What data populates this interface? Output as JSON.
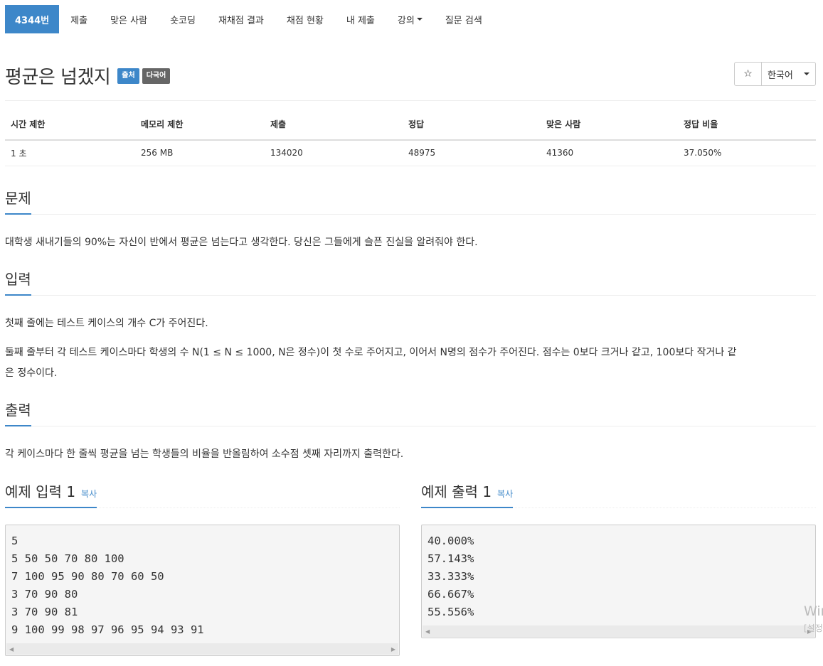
{
  "nav": {
    "items": [
      {
        "label": "4344번",
        "active": true
      },
      {
        "label": "제출"
      },
      {
        "label": "맞은 사람"
      },
      {
        "label": "숏코딩"
      },
      {
        "label": "재채점 결과"
      },
      {
        "label": "채점 현황"
      },
      {
        "label": "내 제출"
      },
      {
        "label": "강의",
        "dropdown": true
      },
      {
        "label": "질문 검색"
      }
    ]
  },
  "problem": {
    "title": "평균은 넘겠지",
    "labels": {
      "source": "출처",
      "multilang": "다국어"
    }
  },
  "toolbar": {
    "star": "☆",
    "language": "한국어"
  },
  "info_table": {
    "headers": [
      "시간 제한",
      "메모리 제한",
      "제출",
      "정답",
      "맞은 사람",
      "정답 비율"
    ],
    "values": [
      "1 초",
      "256 MB",
      "134020",
      "48975",
      "41360",
      "37.050%"
    ]
  },
  "sections": {
    "problem": {
      "heading": "문제",
      "text": "대학생 새내기들의 90%는 자신이 반에서 평균은 넘는다고 생각한다. 당신은 그들에게 슬픈 진실을 알려줘야 한다."
    },
    "input": {
      "heading": "입력",
      "line1": "첫째 줄에는 테스트 케이스의 개수 C가 주어진다.",
      "line2": "둘째 줄부터 각 테스트 케이스마다 학생의 수 N(1 ≤ N ≤ 1000, N은 정수)이 첫 수로 주어지고, 이어서 N명의 점수가 주어진다. 점수는 0보다 크거나 같고, 100보다 작거나 같",
      "line3": "은 정수이다."
    },
    "output": {
      "heading": "출력",
      "text": "각 케이스마다 한 줄씩 평균을 넘는 학생들의 비율을 반올림하여 소수점 셋째 자리까지 출력한다."
    }
  },
  "samples": {
    "input": {
      "heading": "예제 입력 1",
      "copy": "복사",
      "content": "5\n5 50 50 70 80 100\n7 100 95 90 80 70 60 50\n3 70 90 80\n3 70 90 81\n9 100 99 98 97 96 95 94 93 91"
    },
    "output": {
      "heading": "예제 출력 1",
      "copy": "복사",
      "content": "40.000%\n57.143%\n33.333%\n66.667%\n55.556%"
    }
  },
  "watermark": {
    "line1": "Wir",
    "line2": "[설정"
  }
}
